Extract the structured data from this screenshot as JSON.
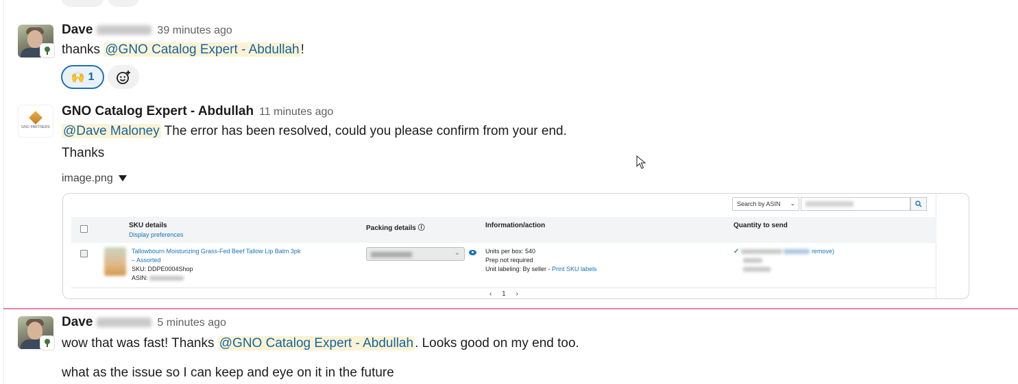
{
  "messages": [
    {
      "author": "Dave",
      "timestamp": "39 minutes ago",
      "text_prefix": "thanks ",
      "mention": "@GNO Catalog Expert - Abdullah",
      "text_suffix": "!",
      "reaction": {
        "emoji": "🙌",
        "count": "1"
      }
    },
    {
      "author": "GNO Catalog Expert - Abdullah",
      "timestamp": "11 minutes ago",
      "mention": "@Dave Maloney",
      "text": " The error has been resolved, could you please confirm from your end.",
      "line2": "Thanks",
      "avatar_text": "GNO PARTNERS",
      "file": {
        "name": "image.png",
        "screenshot": {
          "search_select": "Search by ASIN",
          "columns": [
            "SKU details",
            "Packing details ⓘ",
            "Information/action",
            "Quantity to send"
          ],
          "display_preferences": "Display preferences",
          "product_title_1": "Tallowbourn Moisturizing Grass-Fed Beef Tallow Lip Balm 3pk",
          "product_title_2": "– Assorted",
          "sku": "SKU: DDPE0004Shop",
          "asin_label": "ASIN:",
          "units_per_box": "Units per box: 540",
          "prep": "Prep not required",
          "unit_labeling": "Unit labeling: By seller - ",
          "print_labels": "Print SKU labels",
          "remove": "remove)",
          "pager": "‹ 1 ›"
        }
      }
    },
    {
      "author": "Dave",
      "timestamp": "5 minutes ago",
      "text_prefix": "wow that was fast!  Thanks ",
      "mention": "@GNO Catalog Expert - Abdullah",
      "text_suffix": ".  Looks good on my end too.",
      "line2": "what as the issue so I can keep and eye on it in the future"
    }
  ],
  "colors": {
    "mention_bg": "#fdf3d4",
    "mention_fg": "#1264a3",
    "reaction_border": "#1d6fb8",
    "new_divider": "#e01e5a"
  },
  "icons": [
    "add-reaction-icon",
    "search-icon",
    "dropdown-caret-icon",
    "eye-icon",
    "check-icon",
    "mouse-cursor-icon"
  ]
}
